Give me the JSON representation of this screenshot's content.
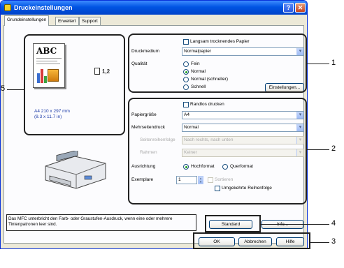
{
  "window": {
    "title": "Druckeinstellungen",
    "help_btn": "?",
    "close_btn": "✕"
  },
  "tabs": [
    {
      "label": "Grundeinstellungen"
    },
    {
      "label": "Erweitert"
    },
    {
      "label": "Support"
    }
  ],
  "preview": {
    "doc_text": "ABC",
    "copies": "1,2",
    "paper_line1": "A4 210 x 297 mm",
    "paper_line2": "(8.3 x 11.7 in)"
  },
  "media": {
    "slow_drying_label": "Langsam trocknendes Papier",
    "medium_label": "Druckmedium",
    "medium_value": "Normalpapier",
    "quality_label": "Qualität",
    "quality_options": [
      "Fein",
      "Normal",
      "Normal (schneller)",
      "Schnell"
    ],
    "quality_selected": "Normal",
    "settings_button": "Einstellungen..."
  },
  "layout": {
    "borderless_label": "Randlos drucken",
    "paper_size_label": "Papiergröße",
    "paper_size_value": "A4",
    "multipage_label": "Mehrseitendruck",
    "multipage_value": "Normal",
    "page_order_label": "Seitenreihenfolge",
    "page_order_value": "Nach rechts, nach unten",
    "border_label": "Rahmen",
    "border_value": "Keiner",
    "orientation_label": "Ausrichtung",
    "portrait_label": "Hochformat",
    "landscape_label": "Querformat",
    "copies_label": "Exemplare",
    "copies_value": "1",
    "collate_label": "Sortieren",
    "reverse_label": "Umgekehrte Reihenfolge"
  },
  "notice": "Das MFC unterbricht den Farb- oder Graustufen-Ausdruck, wenn eine oder mehrere Tintenpatronen leer sind.",
  "buttons": {
    "standard": "Standard",
    "info": "Info...",
    "ok": "OK",
    "cancel": "Abbrechen",
    "help": "Hilfe"
  },
  "callouts": [
    "1",
    "2",
    "3",
    "4",
    "5"
  ]
}
